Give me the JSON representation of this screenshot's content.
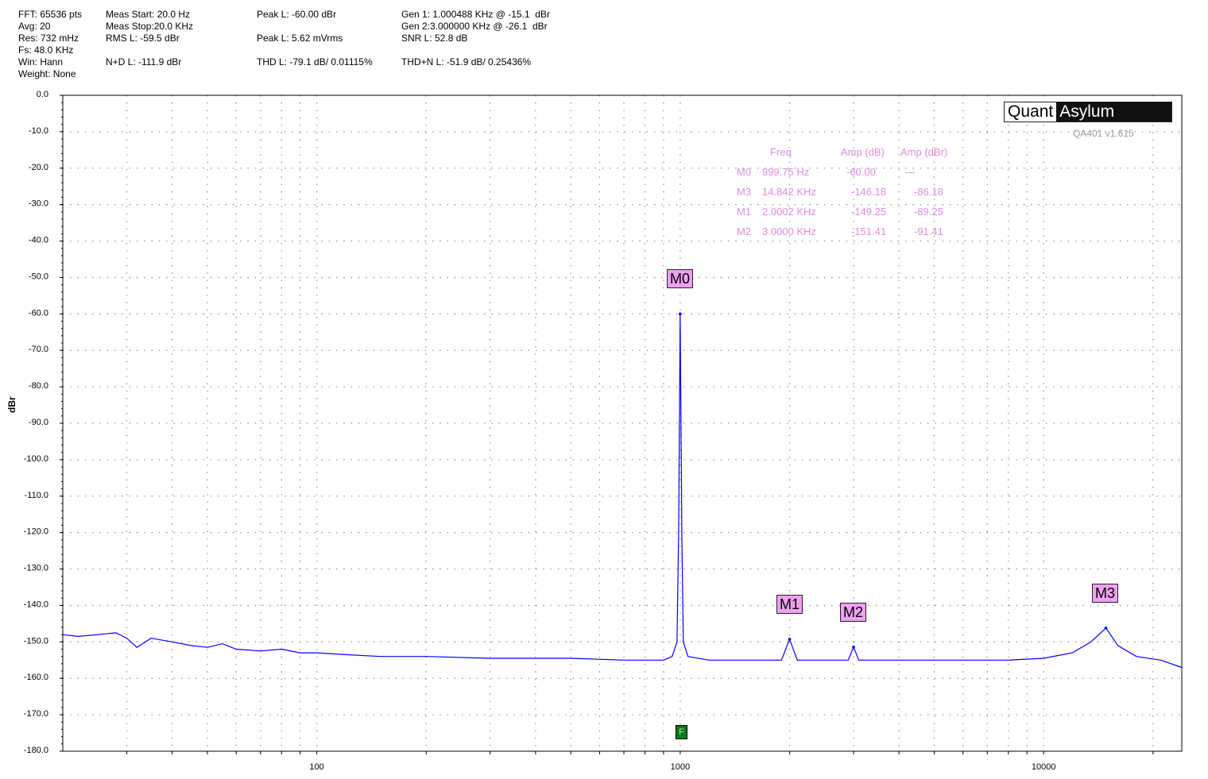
{
  "stats": {
    "fft": "FFT: 65536 pts",
    "avg": "Avg: 20",
    "res": "Res: 732 mHz",
    "fs": "Fs: 48.0 KHz",
    "win": "Win: Hann",
    "weight": "Weight: None",
    "meas_start": "Meas Start: 20.0 Hz",
    "meas_stop": "Meas Stop:20.0 KHz",
    "rms": "RMS L: -59.5 dBr",
    "nd": "N+D L: -111.9 dBr",
    "peak_dbr": "Peak L: -60.00 dBr",
    "peak_mv": "Peak L: 5.62 mVrms",
    "thd": "THD L: -79.1 dB/ 0.01115%",
    "gen1": "Gen 1: 1.000488 KHz @ -15.1  dBr",
    "gen2": "Gen 2:3.000000 KHz @ -26.1  dBr",
    "snr": "SNR L: 52.8 dB",
    "thdn": "THD+N L: -51.9 dB/ 0.25436%"
  },
  "logo": {
    "left": "Quant",
    "right": "Asylum"
  },
  "version": "QA401 v1.615",
  "marker_table": {
    "headers": [
      "Freq",
      "Amp (dB)",
      "Amp (dBr)"
    ],
    "rows": [
      {
        "id": "M0",
        "freq": "999.75 Hz",
        "amp_db": "-60.00",
        "amp_dbr": "---"
      },
      {
        "id": "M3",
        "freq": "14.842 KHz",
        "amp_db": "-146.18",
        "amp_dbr": "-86.18"
      },
      {
        "id": "M1",
        "freq": "2.0002 KHz",
        "amp_db": "-149.25",
        "amp_dbr": "-89.25"
      },
      {
        "id": "M2",
        "freq": "3.0000 KHz",
        "amp_db": "-151.41",
        "amp_dbr": "-91.41"
      }
    ]
  },
  "f_marker_label": "F",
  "chart_data": {
    "type": "line",
    "ylabel": "dBr",
    "xscale": "log",
    "xlim": [
      20,
      24000
    ],
    "ylim": [
      -180,
      0
    ],
    "grid": true,
    "line_color": "#0000ff",
    "marker_color": "#f0a0f0",
    "yticks": [
      "0.0",
      "-10.0",
      "-20.0",
      "-30.0",
      "-40.0",
      "-50.0",
      "-60.0",
      "-70.0",
      "-80.0",
      "-90.0",
      "-100.0",
      "-110.0",
      "-120.0",
      "-130.0",
      "-140.0",
      "-150.0",
      "-160.0",
      "-170.0",
      "-180.0"
    ],
    "xticks": [
      "100",
      "1000",
      "10000"
    ],
    "markers": [
      {
        "name": "M0",
        "x": 999.75,
        "y": -60.0
      },
      {
        "name": "M1",
        "x": 2000.2,
        "y": -149.25
      },
      {
        "name": "M2",
        "x": 3000.0,
        "y": -151.41
      },
      {
        "name": "M3",
        "x": 14842,
        "y": -146.18
      }
    ],
    "series": [
      {
        "points": [
          [
            20,
            -148
          ],
          [
            22,
            -148.5
          ],
          [
            25,
            -148
          ],
          [
            28,
            -147.5
          ],
          [
            30,
            -149
          ],
          [
            32,
            -151.5
          ],
          [
            35,
            -149
          ],
          [
            40,
            -150
          ],
          [
            45,
            -151
          ],
          [
            50,
            -151.5
          ],
          [
            55,
            -150.5
          ],
          [
            60,
            -152
          ],
          [
            70,
            -152.5
          ],
          [
            80,
            -152
          ],
          [
            90,
            -153
          ],
          [
            100,
            -153
          ],
          [
            120,
            -153.5
          ],
          [
            150,
            -154
          ],
          [
            200,
            -154
          ],
          [
            300,
            -154.5
          ],
          [
            500,
            -154.5
          ],
          [
            700,
            -155
          ],
          [
            900,
            -155
          ],
          [
            950,
            -154
          ],
          [
            980,
            -150
          ],
          [
            990,
            -120
          ],
          [
            995,
            -90
          ],
          [
            999.75,
            -60
          ],
          [
            1005,
            -90
          ],
          [
            1010,
            -120
          ],
          [
            1020,
            -150
          ],
          [
            1050,
            -154
          ],
          [
            1200,
            -155
          ],
          [
            1500,
            -155
          ],
          [
            1900,
            -155
          ],
          [
            2000.2,
            -149.25
          ],
          [
            2100,
            -155
          ],
          [
            2500,
            -155
          ],
          [
            2900,
            -155
          ],
          [
            3000,
            -151.41
          ],
          [
            3100,
            -155
          ],
          [
            4000,
            -155
          ],
          [
            6000,
            -155
          ],
          [
            8000,
            -155
          ],
          [
            10000,
            -154.5
          ],
          [
            12000,
            -153
          ],
          [
            13500,
            -150
          ],
          [
            14842,
            -146.18
          ],
          [
            16000,
            -151
          ],
          [
            18000,
            -154
          ],
          [
            21000,
            -155
          ],
          [
            24000,
            -157
          ]
        ]
      }
    ]
  }
}
